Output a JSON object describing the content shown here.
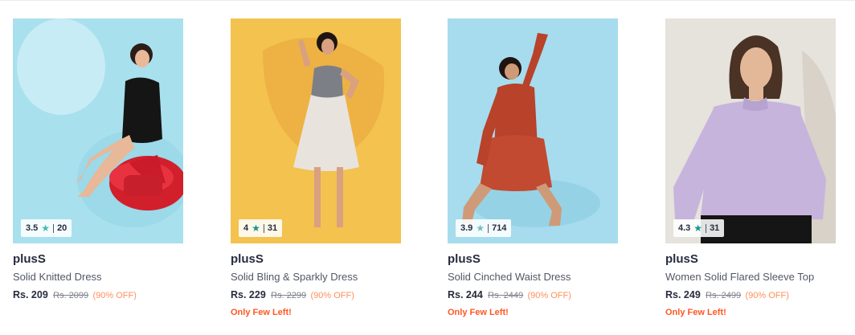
{
  "products": [
    {
      "rating": "3.5",
      "rating_count": "20",
      "brand": "plusS",
      "name": "Solid Knitted Dress",
      "price": "Rs. 209",
      "mrp": "Rs. 2099",
      "discount": "(90% OFF)",
      "stock_note": "",
      "image": {
        "background": "#a9e0ee",
        "garment": "#151515",
        "star_color": "#4ab8b0"
      }
    },
    {
      "rating": "4",
      "rating_count": "31",
      "brand": "plusS",
      "name": "Solid Bling & Sparkly Dress",
      "price": "Rs. 229",
      "mrp": "Rs. 2299",
      "discount": "(90% OFF)",
      "stock_note": "Only Few Left!",
      "image": {
        "background": "#f3c24f",
        "garment": "#e8e3dd",
        "star_color": "#14958f"
      }
    },
    {
      "rating": "3.9",
      "rating_count": "714",
      "brand": "plusS",
      "name": "Solid Cinched Waist Dress",
      "price": "Rs. 244",
      "mrp": "Rs. 2449",
      "discount": "(90% OFF)",
      "stock_note": "Only Few Left!",
      "image": {
        "background": "#a6dcee",
        "garment": "#b8422a",
        "star_color": "#72bfbc"
      }
    },
    {
      "rating": "4.3",
      "rating_count": "31",
      "brand": "plusS",
      "name": "Women Solid Flared Sleeve Top",
      "price": "Rs. 249",
      "mrp": "Rs. 2499",
      "discount": "(90% OFF)",
      "stock_note": "Only Few Left!",
      "image": {
        "background": "#e6e2dc",
        "garment": "#c6b4dc",
        "star_color": "#14958f"
      }
    }
  ]
}
